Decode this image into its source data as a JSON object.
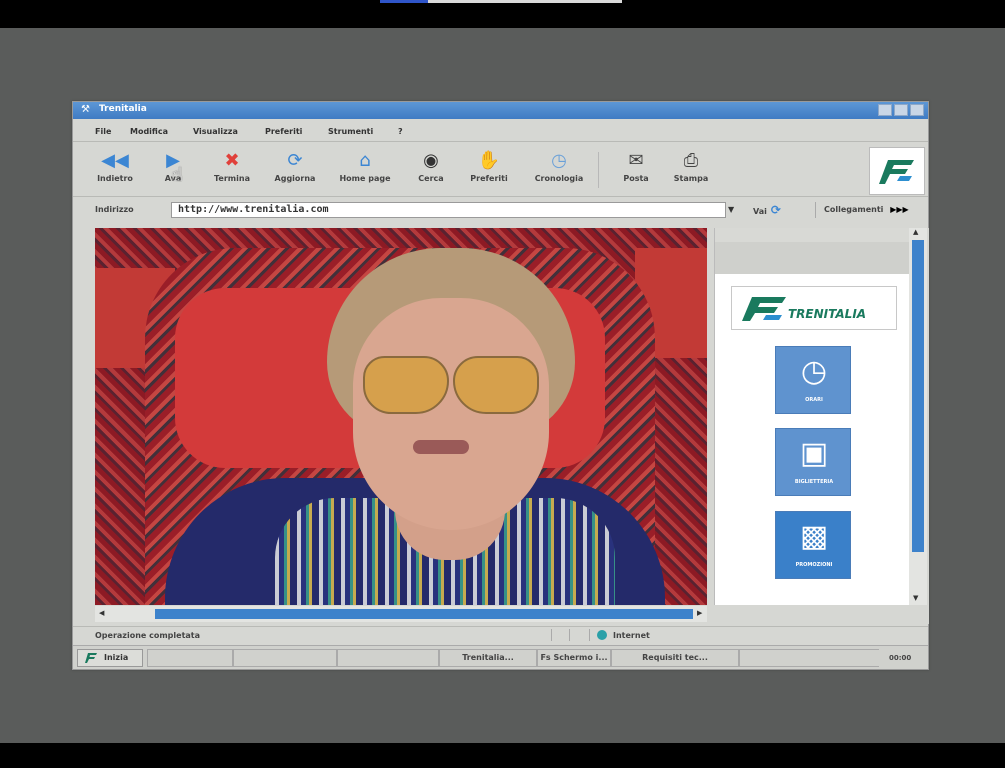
{
  "window": {
    "title": "Trenitalia"
  },
  "menu": [
    "File",
    "Modifica",
    "Visualizza",
    "Preferiti",
    "Strumenti",
    "?"
  ],
  "toolbar": {
    "buttons": [
      {
        "label": "Indietro",
        "icon": "back-arrows-icon"
      },
      {
        "label": "Ava",
        "icon": "forward-arrow-icon"
      },
      {
        "label": "Termina",
        "icon": "stop-icon"
      },
      {
        "label": "Aggiorna",
        "icon": "refresh-icon"
      },
      {
        "label": "Home page",
        "icon": "home-icon"
      },
      {
        "label": "Cerca",
        "icon": "eye-icon"
      },
      {
        "label": "Preferiti",
        "icon": "favorites-hand-icon"
      },
      {
        "label": "Cronologia",
        "icon": "history-clock-icon"
      },
      {
        "label": "Posta",
        "icon": "mail-icon"
      },
      {
        "label": "Stampa",
        "icon": "print-icon"
      }
    ]
  },
  "address": {
    "label": "Indirizzo",
    "value": "http://www.trenitalia.com",
    "go_label": "Vai",
    "links_label": "Collegamenti"
  },
  "side_panel": {
    "brand": "TRENITALIA",
    "tiles": [
      {
        "label": "ORARI",
        "icon": "clock-icon"
      },
      {
        "label": "BIGLIETTERIA",
        "icon": "ticket-icon"
      },
      {
        "label": "PROMOZIONI",
        "icon": "gift-icon"
      }
    ]
  },
  "status": {
    "message": "Operazione completata",
    "zone": "Internet"
  },
  "taskbar": {
    "start_label": "Inizia",
    "tasks": [
      "Trenitalia...",
      "Fs Schermo i...",
      "Requisiti tec..."
    ],
    "clock": "00:00"
  },
  "colors": {
    "titlebar": "#4a86cc",
    "accent_blue": "#3d82cb",
    "brand_green": "#1a7a5e"
  }
}
